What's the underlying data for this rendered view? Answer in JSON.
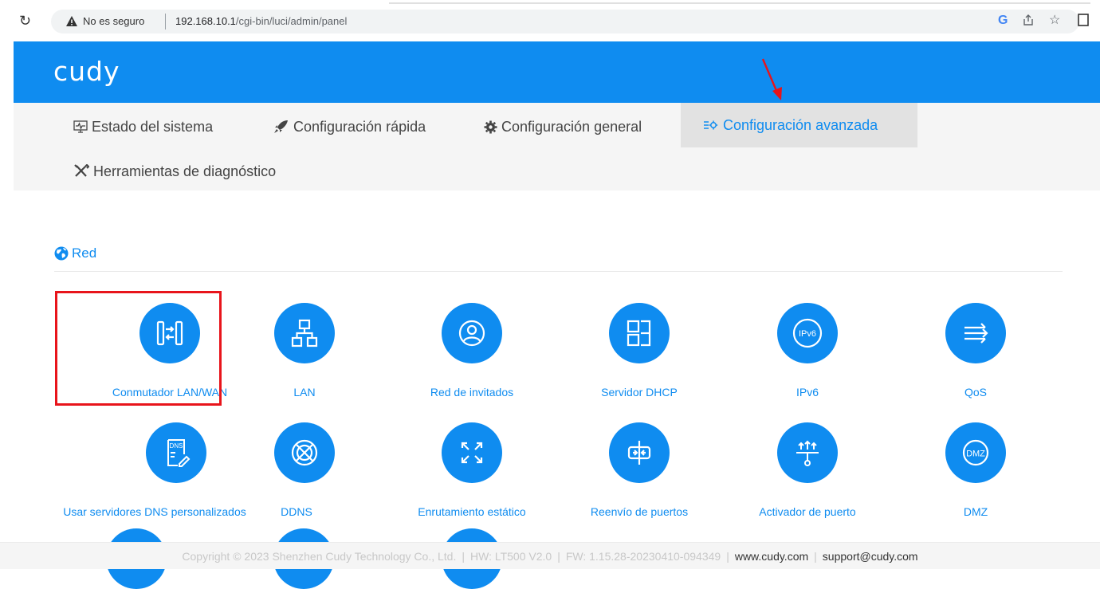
{
  "browser": {
    "insecure_label": "No es seguro",
    "url_host": "192.168.10.1",
    "url_path": "/cgi-bin/luci/admin/panel",
    "google_icon": "G"
  },
  "brand": {
    "logo": "cudy",
    "color": "#0f8cf0"
  },
  "nav": {
    "status": "Estado del sistema",
    "quick": "Configuración rápida",
    "general": "Configuración general",
    "advanced": "Configuración avanzada",
    "diagnostics": "Herramientas de diagnóstico",
    "active": "advanced"
  },
  "section": {
    "title": "Red",
    "tiles": [
      {
        "label": "Conmutador LAN/WAN",
        "icon": "lan-wan-switch-icon"
      },
      {
        "label": "LAN",
        "icon": "lan-topology-icon"
      },
      {
        "label": "Red de invitados",
        "icon": "guest-user-icon"
      },
      {
        "label": "Servidor DHCP",
        "icon": "dhcp-server-icon"
      },
      {
        "label": "IPv6",
        "icon": "ipv6-icon",
        "badge": "IPv6"
      },
      {
        "label": "QoS",
        "icon": "qos-arrows-icon"
      },
      {
        "label": "Usar servidores DNS personalizados",
        "icon": "dns-edit-icon",
        "badge": "DNS"
      },
      {
        "label": "DDNS",
        "icon": "ddns-globe-icon"
      },
      {
        "label": "Enrutamiento estático",
        "icon": "static-routing-icon"
      },
      {
        "label": "Reenvío de puertos",
        "icon": "port-forwarding-icon"
      },
      {
        "label": "Activador de puerto",
        "icon": "port-trigger-icon"
      },
      {
        "label": "DMZ",
        "icon": "dmz-icon",
        "badge": "DMZ"
      }
    ]
  },
  "footer": {
    "copyright": "Copyright © 2023 Shenzhen Cudy Technology Co., Ltd.",
    "hw": "HW: LT500 V2.0",
    "fw": "FW: 1.15.28-20230410-094349",
    "website": "www.cudy.com",
    "email": "support@cudy.com"
  },
  "annotation": {
    "highlight_color": "#e8141b"
  }
}
